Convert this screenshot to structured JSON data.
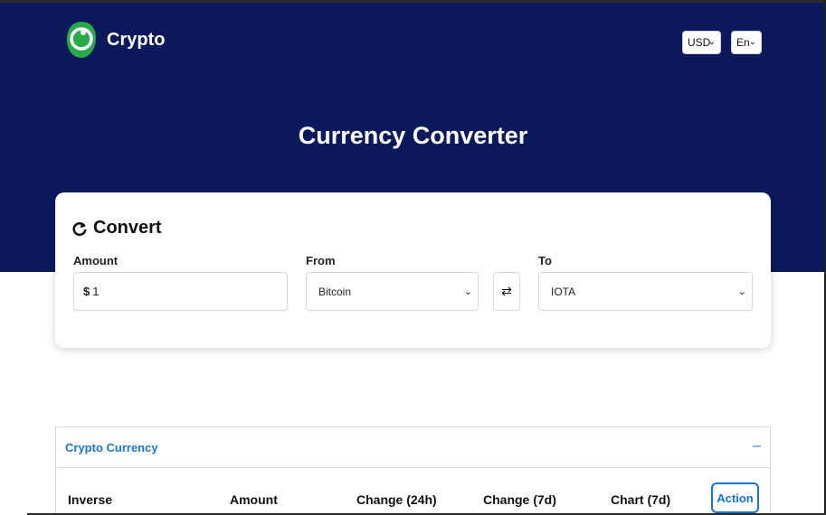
{
  "header": {
    "brand": "Crypto",
    "currency_select": "USD",
    "language_select": "En"
  },
  "hero": {
    "title": "Currency Converter"
  },
  "converter": {
    "title": "Convert",
    "amount_label": "Amount",
    "amount_symbol": "$",
    "amount_value": "1",
    "from_label": "From",
    "from_value": "Bitcoin",
    "to_label": "To",
    "to_value": "IOTA",
    "swap_icon": "⇄"
  },
  "table_panel": {
    "title": "Crypto Currency",
    "collapse_icon": "–",
    "columns": [
      "Inverse",
      "Amount",
      "Change (24h)",
      "Change (7d)",
      "Chart (7d)"
    ],
    "action_label": "Action"
  },
  "colors": {
    "hero_bg": "#0c1a5c",
    "accent": "#1a73d0",
    "logo_green": "#2aa84a"
  }
}
